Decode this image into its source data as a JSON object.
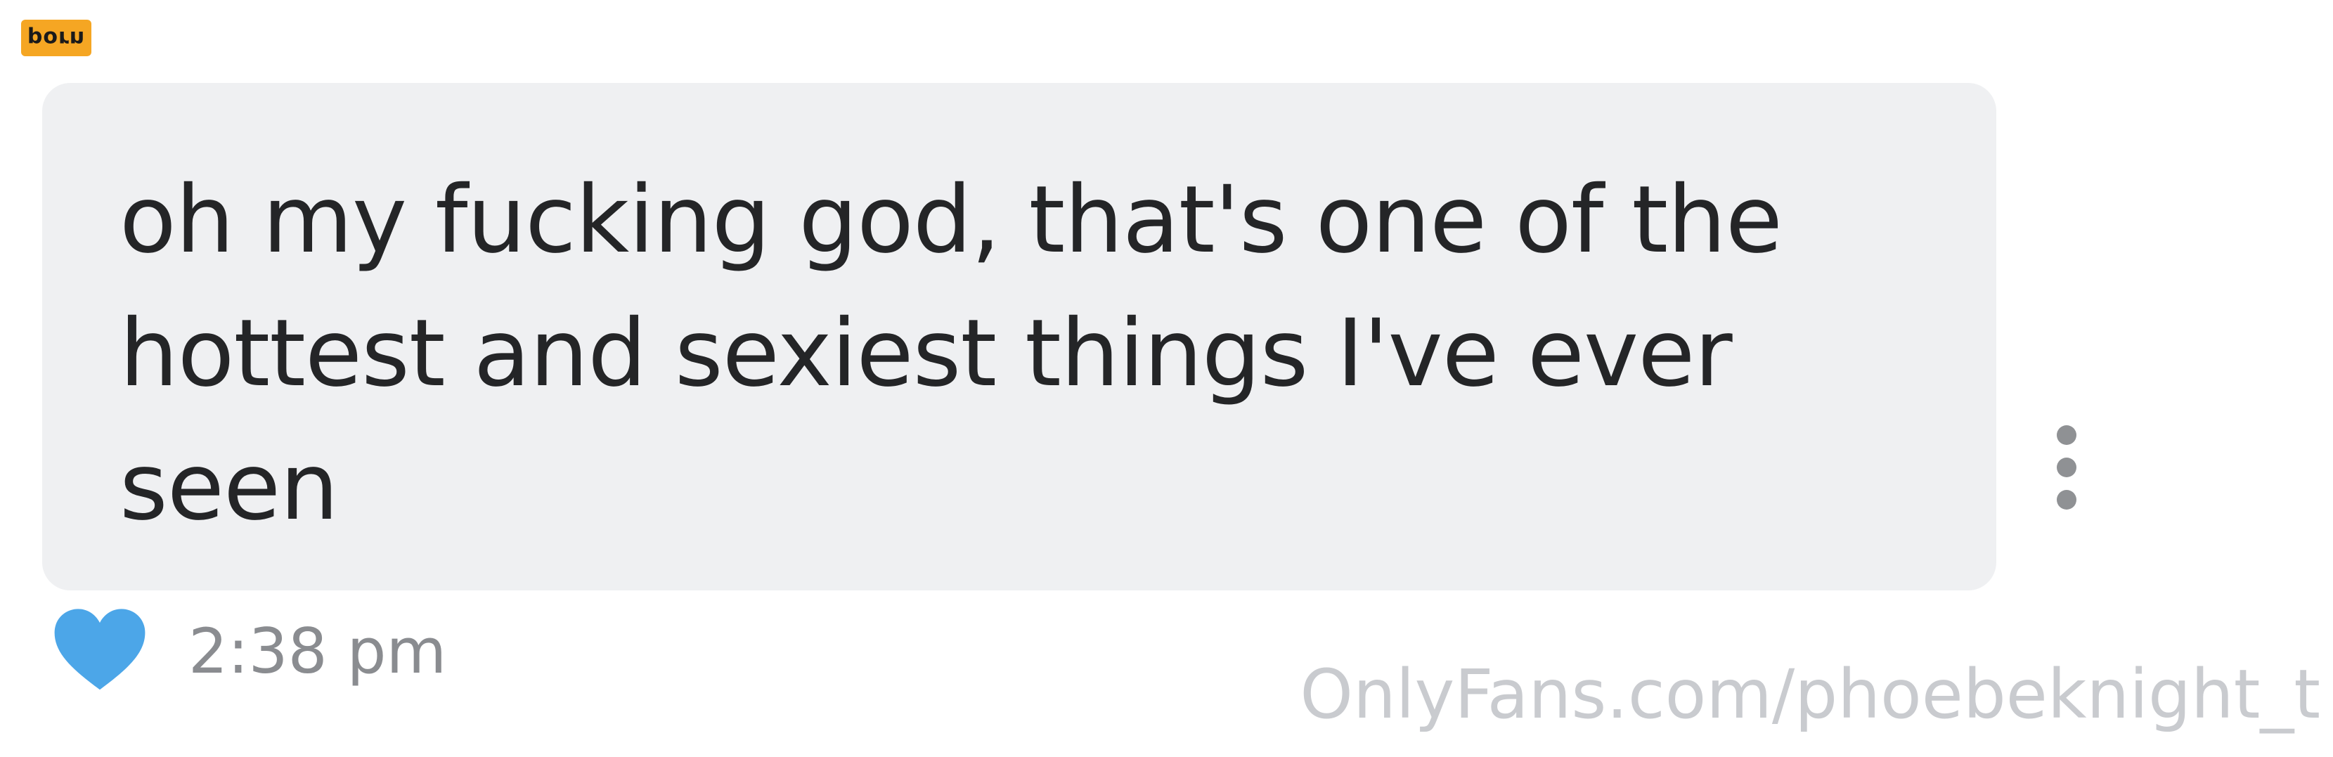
{
  "corner_badge": {
    "text": "porn"
  },
  "message": {
    "text": "oh my fucking god, that's one of the hottest and sexiest things I've ever seen",
    "time": "2:38 pm",
    "liked": true,
    "heart_color": "#4ca6e8",
    "bubble_color": "#eff0f2"
  },
  "actions": {
    "more_icon": "vertical-dots-icon"
  },
  "watermark": {
    "text": "OnlyFans.com/phoebeknight_t"
  }
}
